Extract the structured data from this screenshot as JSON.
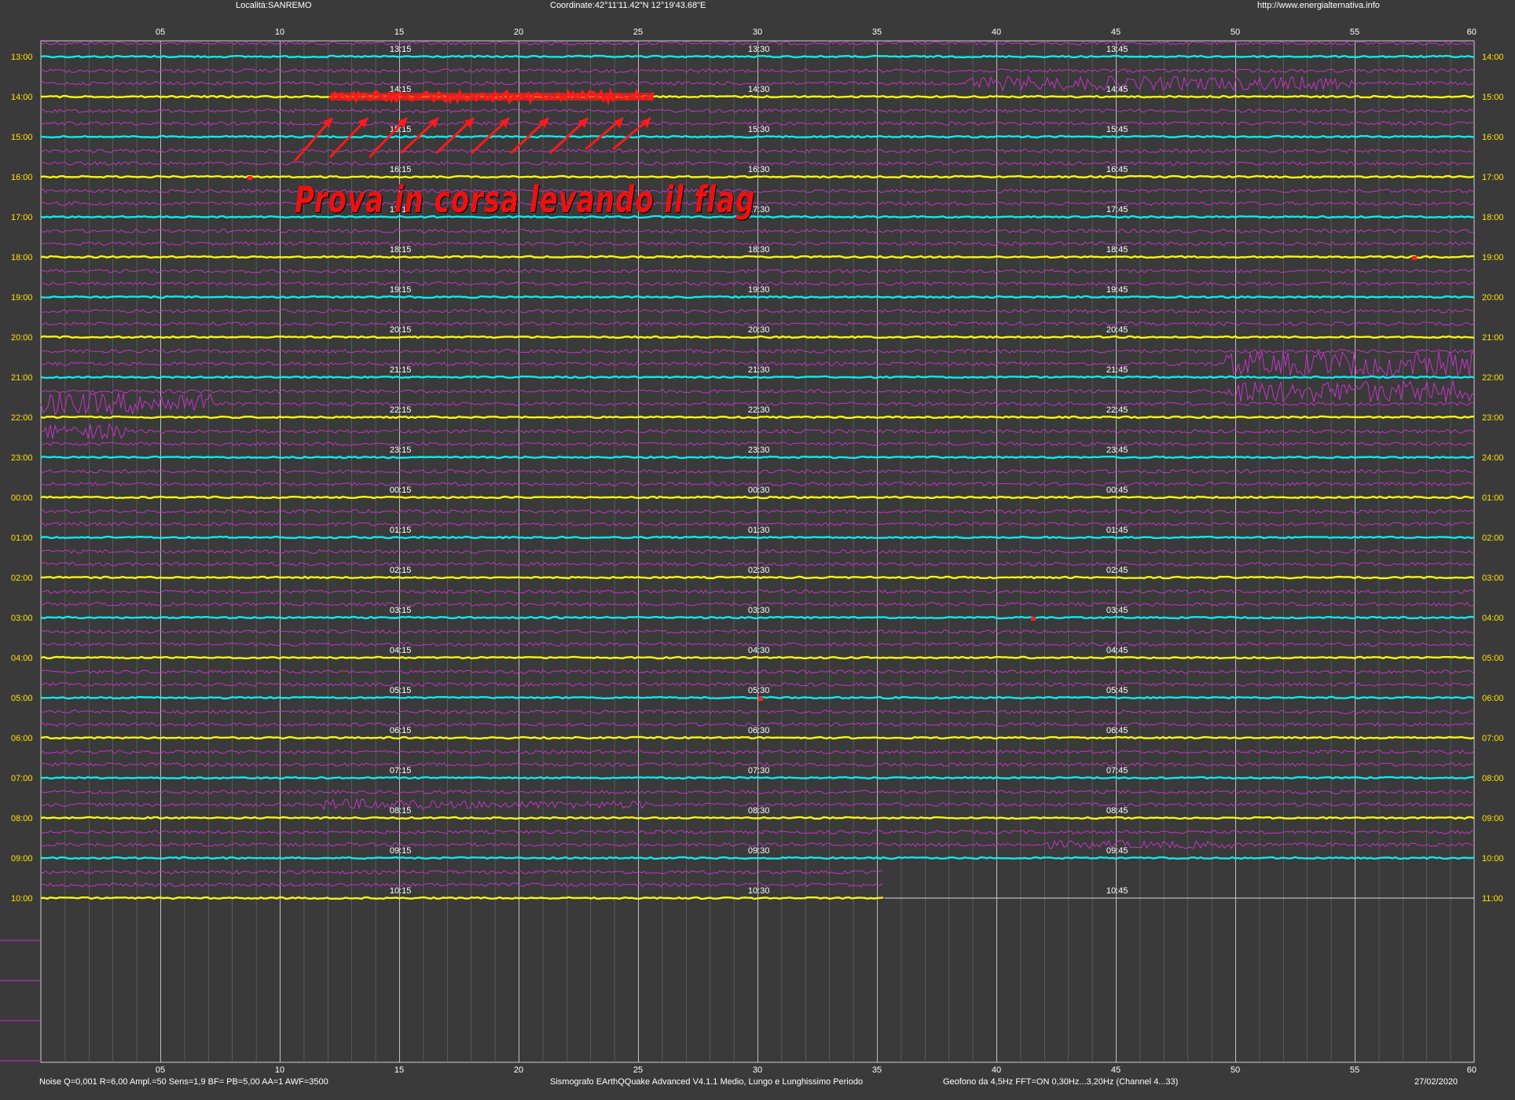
{
  "header": {
    "location": "Località:SANREMO",
    "coordinates": "Coordinate:42°11'11.42\"N  12°19'43.68\"E",
    "url": "http://www.energialternativa.info"
  },
  "footer": {
    "params": "Noise Q=0,001 R=6,00 Ampl.=50 Sens=1,9 BF= PB=5,00 AA=1 AWF=3500",
    "software": "Sismografo  EArthQQuake Advanced V4.1.1  Medio, Lungo e Lunghissimo Periodo",
    "geophone": "Geofono da 4,5Hz FFT=ON 0,30Hz...3,20Hz      (Channel 4...33)",
    "date": "27/02/2020"
  },
  "annotation": {
    "text": "Prova in corsa levando il flag"
  },
  "minute_ticks": [
    "05",
    "10",
    "15",
    "20",
    "25",
    "30",
    "35",
    "40",
    "45",
    "50",
    "55",
    "60"
  ],
  "rows": [
    {
      "left": "13:00",
      "right": "14:00",
      "q15": "13:15",
      "q30": "13:30",
      "q45": "13:45"
    },
    {
      "left": "14:00",
      "right": "15:00",
      "q15": "14:15",
      "q30": "14:30",
      "q45": "14:45"
    },
    {
      "left": "15:00",
      "right": "16:00",
      "q15": "15:15",
      "q30": "15:30",
      "q45": "15:45"
    },
    {
      "left": "16:00",
      "right": "17:00",
      "q15": "16:15",
      "q30": "16:30",
      "q45": "16:45"
    },
    {
      "left": "17:00",
      "right": "18:00",
      "q15": "17:15",
      "q30": "17:30",
      "q45": "17:45"
    },
    {
      "left": "18:00",
      "right": "19:00",
      "q15": "18:15",
      "q30": "18:30",
      "q45": "18:45"
    },
    {
      "left": "19:00",
      "right": "20:00",
      "q15": "19:15",
      "q30": "19:30",
      "q45": "19:45"
    },
    {
      "left": "20:00",
      "right": "21:00",
      "q15": "20:15",
      "q30": "20:30",
      "q45": "20:45"
    },
    {
      "left": "21:00",
      "right": "22:00",
      "q15": "21:15",
      "q30": "21:30",
      "q45": "21:45"
    },
    {
      "left": "22:00",
      "right": "23:00",
      "q15": "22:15",
      "q30": "22:30",
      "q45": "22:45"
    },
    {
      "left": "23:00",
      "right": "24:00",
      "q15": "23:15",
      "q30": "23:30",
      "q45": "23:45"
    },
    {
      "left": "00:00",
      "right": "01:00",
      "q15": "00:15",
      "q30": "00:30",
      "q45": "00:45"
    },
    {
      "left": "01:00",
      "right": "02:00",
      "q15": "01:15",
      "q30": "01:30",
      "q45": "01:45"
    },
    {
      "left": "02:00",
      "right": "03:00",
      "q15": "02:15",
      "q30": "02:30",
      "q45": "02:45"
    },
    {
      "left": "03:00",
      "right": "04:00",
      "q15": "03:15",
      "q30": "03:30",
      "q45": "03:45"
    },
    {
      "left": "04:00",
      "right": "05:00",
      "q15": "04:15",
      "q30": "04:30",
      "q45": "04:45"
    },
    {
      "left": "05:00",
      "right": "06:00",
      "q15": "05:15",
      "q30": "05:30",
      "q45": "05:45"
    },
    {
      "left": "06:00",
      "right": "07:00",
      "q15": "06:15",
      "q30": "06:30",
      "q45": "06:45"
    },
    {
      "left": "07:00",
      "right": "08:00",
      "q15": "07:15",
      "q30": "07:30",
      "q45": "07:45"
    },
    {
      "left": "08:00",
      "right": "09:00",
      "q15": "08:15",
      "q30": "08:30",
      "q45": "08:45"
    },
    {
      "left": "09:00",
      "right": "10:00",
      "q15": "09:15",
      "q30": "09:30",
      "q45": "09:45"
    },
    {
      "left": "10:00",
      "right": "11:00",
      "q15": "10:15",
      "q30": "10:30",
      "q45": "10:45"
    }
  ],
  "colors": {
    "background": "#3a3a3a",
    "grid": "#6e6e6e",
    "major_grid": "#cfcfcf",
    "trace_cyan": "#19e6e6",
    "trace_yellow": "#f5f51e",
    "trace_magenta": "#c832c8",
    "hour_label": "#ffe400",
    "quarter_label": "#ffffff",
    "annotation": "#ee1111"
  }
}
